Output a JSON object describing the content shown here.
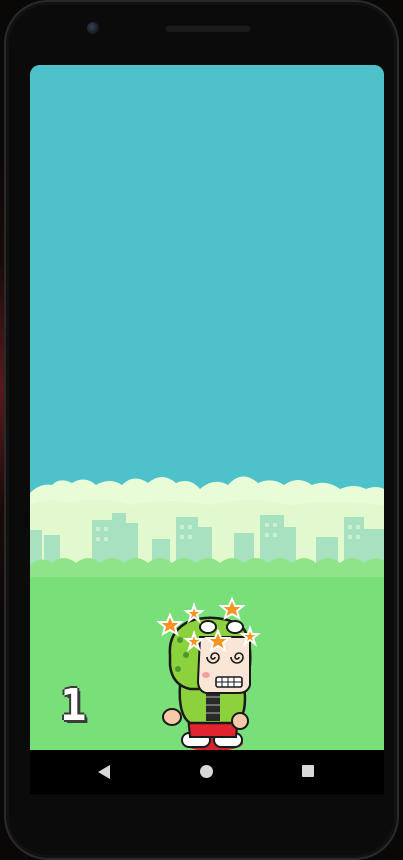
{
  "game": {
    "score": "1",
    "state": "game-over",
    "player": {
      "character": "dino-hood-kid",
      "status": "dizzy"
    }
  },
  "device": {
    "nav": {
      "back_icon": "back-triangle-icon",
      "home_icon": "home-circle-icon",
      "recents_icon": "recents-square-icon"
    }
  },
  "colors": {
    "sky": "#4ec2cb",
    "clouds": "#e9fcd8",
    "buildings": "#a8e1c0",
    "bushes": "#7fdd74",
    "ground": "#79df79",
    "score_fill": "#ffffff",
    "score_outline": "#3b3b3b"
  }
}
